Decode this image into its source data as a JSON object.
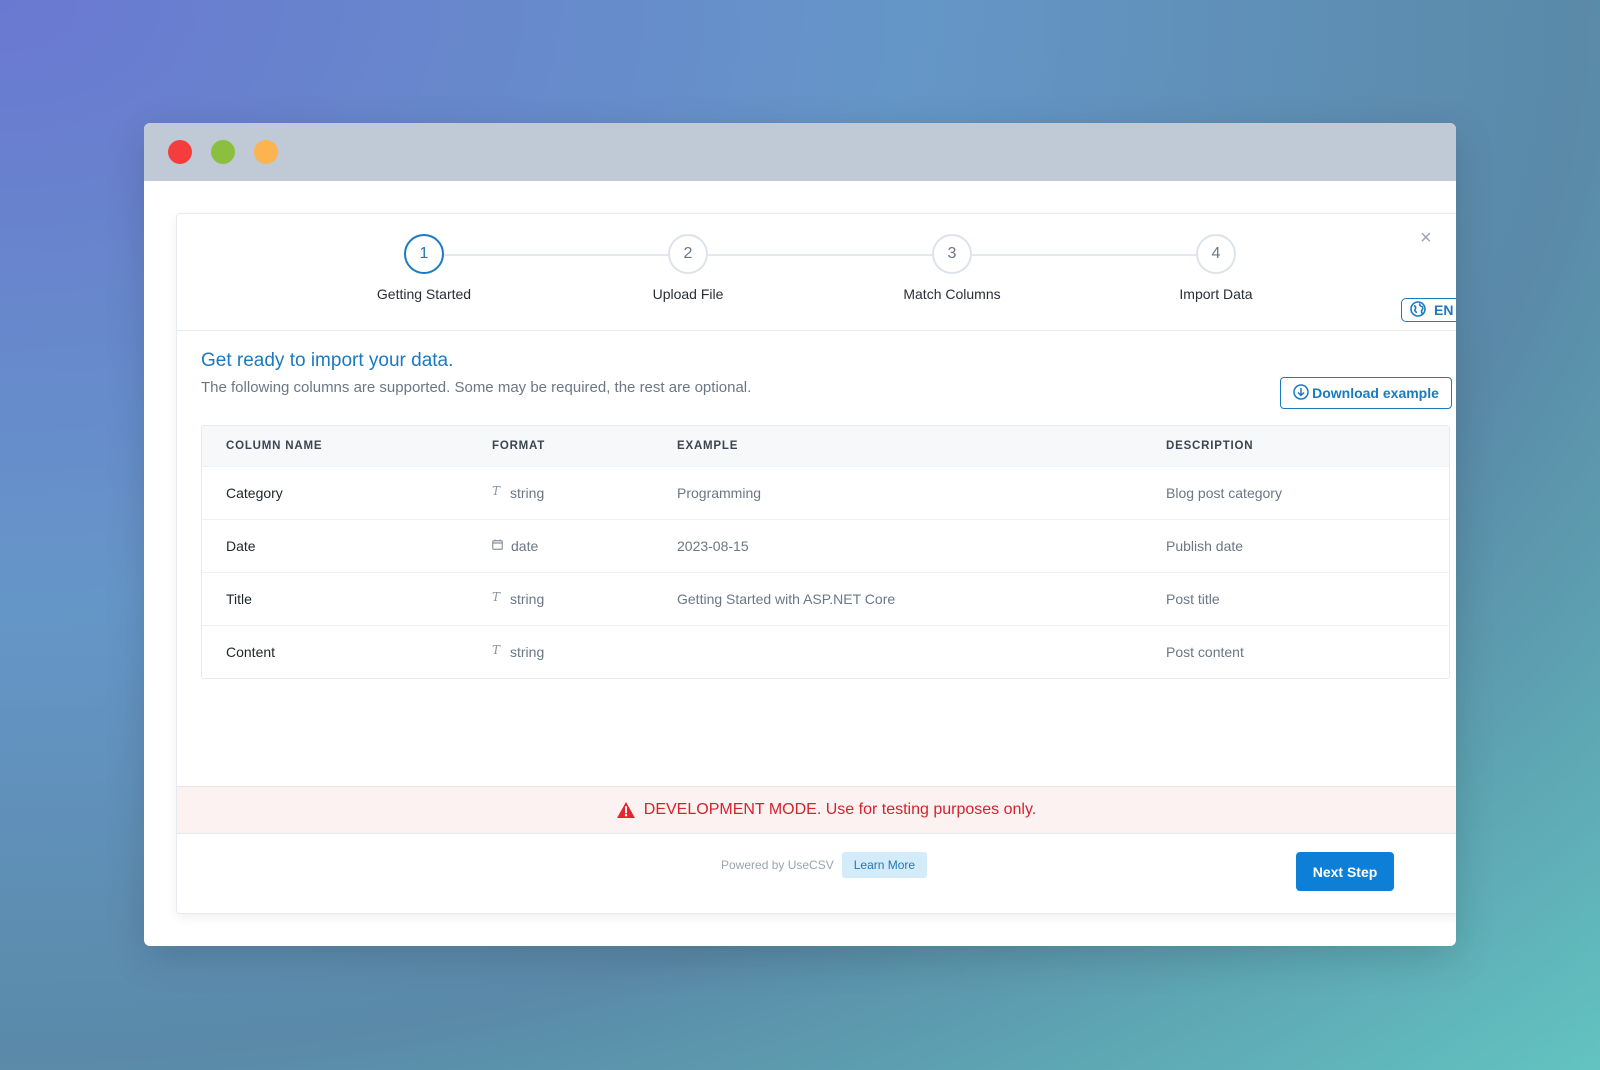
{
  "window": {
    "controls": [
      "close-dot",
      "maximize-dot",
      "minimize-dot"
    ]
  },
  "steps": [
    {
      "number": "1",
      "label": "Getting Started",
      "active": true
    },
    {
      "number": "2",
      "label": "Upload File",
      "active": false
    },
    {
      "number": "3",
      "label": "Match Columns",
      "active": false
    },
    {
      "number": "4",
      "label": "Import Data",
      "active": false
    }
  ],
  "close_glyph": "×",
  "language": {
    "label": "EN",
    "icon": "globe-icon"
  },
  "intro": {
    "heading": "Get ready to import your data.",
    "subheading": "The following columns are supported. Some may be required, the rest are optional."
  },
  "download": {
    "label": "Download example",
    "icon": "download-circle-icon"
  },
  "table": {
    "headers": [
      "COLUMN NAME",
      "FORMAT",
      "EXAMPLE",
      "DESCRIPTION"
    ],
    "rows": [
      {
        "name": "Category",
        "format": "string",
        "format_icon": "T",
        "example": "Programming",
        "description": "Blog post category"
      },
      {
        "name": "Date",
        "format": "date",
        "format_icon": "calendar-icon",
        "example": "2023-08-15",
        "description": "Publish date"
      },
      {
        "name": "Title",
        "format": "string",
        "format_icon": "T",
        "example": "Getting Started with ASP.NET Core",
        "description": "Post title"
      },
      {
        "name": "Content",
        "format": "string",
        "format_icon": "T",
        "example": "",
        "description": "Post content"
      }
    ]
  },
  "dev_banner": {
    "text": "DEVELOPMENT MODE. Use for testing purposes only.",
    "icon": "warning-icon"
  },
  "footer": {
    "powered_by": "Powered by UseCSV",
    "learn_more": "Learn More",
    "next_step": "Next Step"
  },
  "colors": {
    "accent": "#1a7ac0",
    "primary_button": "#0d7fd6",
    "danger": "#d6222c"
  }
}
